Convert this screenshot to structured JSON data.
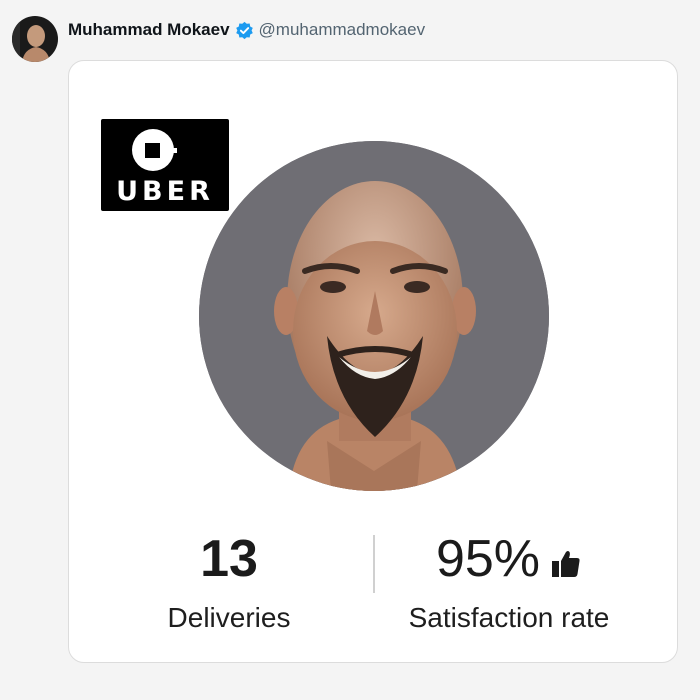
{
  "tweet": {
    "author_name": "Muhammad Mokaev",
    "author_handle": "@muhammadmokaev",
    "verified": true
  },
  "card": {
    "logo_text": "UBER",
    "stats": [
      {
        "value": "13",
        "label": "Deliveries"
      },
      {
        "value": "95%",
        "label": "Satisfaction rate",
        "icon": "thumbs-up-icon"
      }
    ]
  },
  "colors": {
    "verified_badge": "#1d9bf0",
    "handle_text": "#536471",
    "photo_background": "#6f6e74",
    "logo_background": "#000000"
  }
}
